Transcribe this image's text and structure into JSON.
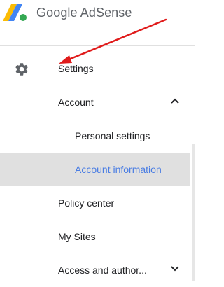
{
  "header": {
    "brand": "Google AdSense",
    "logo_icon": "adsense-logo-icon"
  },
  "nav": {
    "settings": {
      "label": "Settings",
      "icon": "gear-icon"
    },
    "account": {
      "label": "Account",
      "expanded": true
    },
    "personal_settings": {
      "label": "Personal settings"
    },
    "account_information": {
      "label": "Account information",
      "selected": true
    },
    "policy_center": {
      "label": "Policy center"
    },
    "my_sites": {
      "label": "My Sites"
    },
    "access_authorization": {
      "label": "Access and author...",
      "expanded": false
    }
  },
  "colors": {
    "selected_text": "#4a7de3",
    "selected_bg": "#e0e0e0",
    "annotation_arrow": "#e01b1b"
  }
}
